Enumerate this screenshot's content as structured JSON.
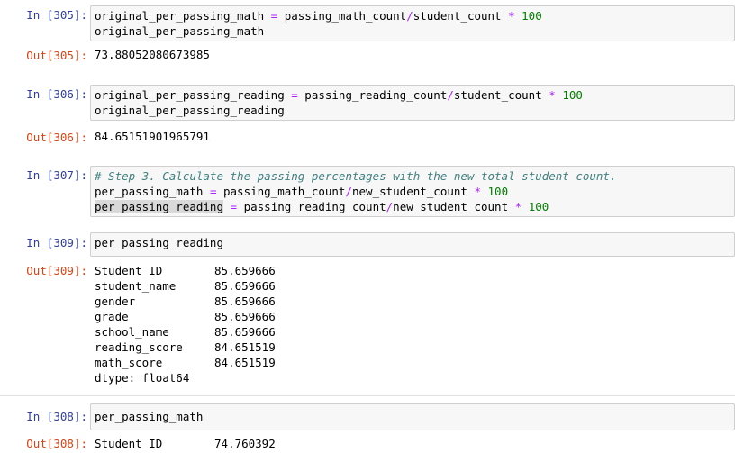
{
  "cells": [
    {
      "in_prompt": "In [305]:",
      "code": [
        [
          {
            "t": "original_per_passing_math ",
            "c": ""
          },
          {
            "t": "=",
            "c": "op"
          },
          {
            "t": " passing_math_count",
            "c": ""
          },
          {
            "t": "/",
            "c": "op"
          },
          {
            "t": "student_count ",
            "c": ""
          },
          {
            "t": "*",
            "c": "op"
          },
          {
            "t": " ",
            "c": ""
          },
          {
            "t": "100",
            "c": "num"
          }
        ],
        [
          {
            "t": "original_per_passing_math",
            "c": ""
          }
        ]
      ],
      "out_prompt": "Out[305]:",
      "output": "73.88052080673985"
    },
    {
      "in_prompt": "In [306]:",
      "code": [
        [
          {
            "t": "original_per_passing_reading ",
            "c": ""
          },
          {
            "t": "=",
            "c": "op"
          },
          {
            "t": " passing_reading_count",
            "c": ""
          },
          {
            "t": "/",
            "c": "op"
          },
          {
            "t": "student_count ",
            "c": ""
          },
          {
            "t": "*",
            "c": "op"
          },
          {
            "t": " ",
            "c": ""
          },
          {
            "t": "100",
            "c": "num"
          }
        ],
        [
          {
            "t": "original_per_passing_reading",
            "c": ""
          }
        ]
      ],
      "out_prompt": "Out[306]:",
      "output": "84.65151901965791"
    },
    {
      "in_prompt": "In [307]:",
      "code": [
        [
          {
            "t": "# Step 3. Calculate the passing percentages with the new total student count.",
            "c": "comment"
          }
        ],
        [
          {
            "t": "per_passing_math ",
            "c": ""
          },
          {
            "t": "=",
            "c": "op"
          },
          {
            "t": " passing_math_count",
            "c": ""
          },
          {
            "t": "/",
            "c": "op"
          },
          {
            "t": "new_student_count ",
            "c": ""
          },
          {
            "t": "*",
            "c": "op"
          },
          {
            "t": " ",
            "c": ""
          },
          {
            "t": "100",
            "c": "num"
          }
        ],
        [
          {
            "t": "per_passing_reading",
            "c": "hl"
          },
          {
            "t": " ",
            "c": ""
          },
          {
            "t": "=",
            "c": "op"
          },
          {
            "t": " passing_reading_count",
            "c": ""
          },
          {
            "t": "/",
            "c": "op"
          },
          {
            "t": "new_student_count ",
            "c": ""
          },
          {
            "t": "*",
            "c": "op"
          },
          {
            "t": " ",
            "c": ""
          },
          {
            "t": "100",
            "c": "num"
          }
        ]
      ]
    },
    {
      "in_prompt": "In [309]:",
      "code": [
        [
          {
            "t": "per_passing_reading",
            "c": ""
          }
        ]
      ],
      "out_prompt": "Out[309]:",
      "series": [
        {
          "label": "Student ID",
          "value": "85.659666"
        },
        {
          "label": "student_name",
          "value": "85.659666"
        },
        {
          "label": "gender",
          "value": "85.659666"
        },
        {
          "label": "grade",
          "value": "85.659666"
        },
        {
          "label": "school_name",
          "value": "85.659666"
        },
        {
          "label": "reading_score",
          "value": "84.651519"
        },
        {
          "label": "math_score",
          "value": "84.651519"
        }
      ],
      "dtype": "dtype: float64"
    },
    {
      "in_prompt": "In [308]:",
      "code": [
        [
          {
            "t": "per_passing_math",
            "c": ""
          }
        ]
      ],
      "out_prompt": "Out[308]:",
      "series": [
        {
          "label": "Student ID",
          "value": "74.760392"
        }
      ]
    }
  ]
}
